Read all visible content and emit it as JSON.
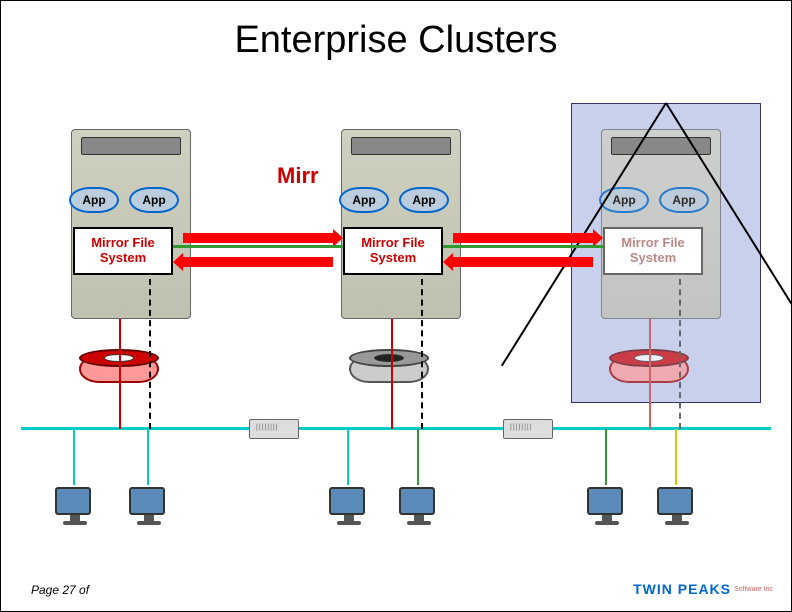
{
  "title": "Enterprise Clusters",
  "subtitle": "Mirr",
  "servers": [
    {
      "app1": "App",
      "app2": "App",
      "mfs_line1": "Mirror File",
      "mfs_line2": "System"
    },
    {
      "app1": "App",
      "app2": "App",
      "mfs_line1": "Mirror File",
      "mfs_line2": "System"
    },
    {
      "app1": "App",
      "app2": "App",
      "mfs_line1": "Mirror File",
      "mfs_line2": "System"
    }
  ],
  "page_label": "Page 27 of",
  "logo_main": "TWIN PEAKS",
  "logo_sub": "Software Inc"
}
